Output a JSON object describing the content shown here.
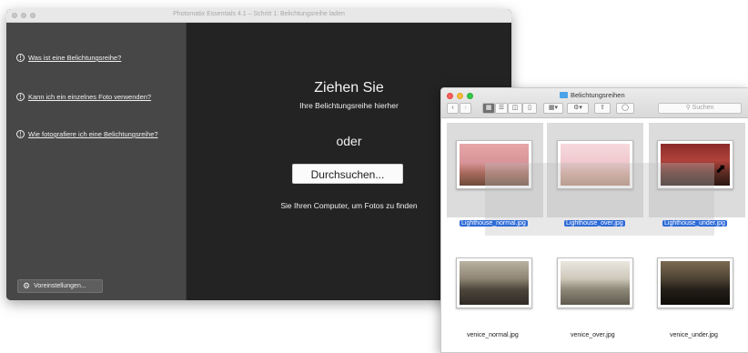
{
  "photomatix": {
    "window_title": "Photomatix Essentials 4.1 – Schritt 1: Belichtungsreihe laden",
    "help_links": [
      "Was ist eine Belichtungsreihe?",
      "Kann ich ein einzelnes Foto verwenden?",
      "Wie fotografiere ich eine Belichtungsreihe?"
    ],
    "preferences_button": "Voreinstellungen...",
    "drop_title": "Ziehen Sie",
    "drop_subtitle": "Ihre Belichtungsreihe hierher",
    "or_label": "oder",
    "browse_button": "Durchsuchen...",
    "browse_hint": "Sie Ihren Computer, um Fotos zu finden"
  },
  "finder": {
    "title": "Belichtungsreihen",
    "search_placeholder": "Suchen",
    "toolbar_icons": [
      "back-icon",
      "forward-icon",
      "icon-view-icon",
      "list-view-icon",
      "column-view-icon",
      "coverflow-view-icon",
      "arrange-icon",
      "action-gear-icon",
      "share-icon",
      "tag-icon"
    ],
    "files": [
      {
        "name": "Lighthouse_normal.jpg",
        "selected": true
      },
      {
        "name": "Lighthouse_over.jpg",
        "selected": true
      },
      {
        "name": "Lighthouse_under.jpg",
        "selected": true
      },
      {
        "name": "venice_normal.jpg",
        "selected": false
      },
      {
        "name": "venice_over.jpg",
        "selected": false
      },
      {
        "name": "venice_under.jpg",
        "selected": false
      }
    ],
    "colors": {
      "selection": "#2e6bd8",
      "close": "#fc605c",
      "minimize": "#fdbc40",
      "zoom": "#34c84a"
    }
  }
}
